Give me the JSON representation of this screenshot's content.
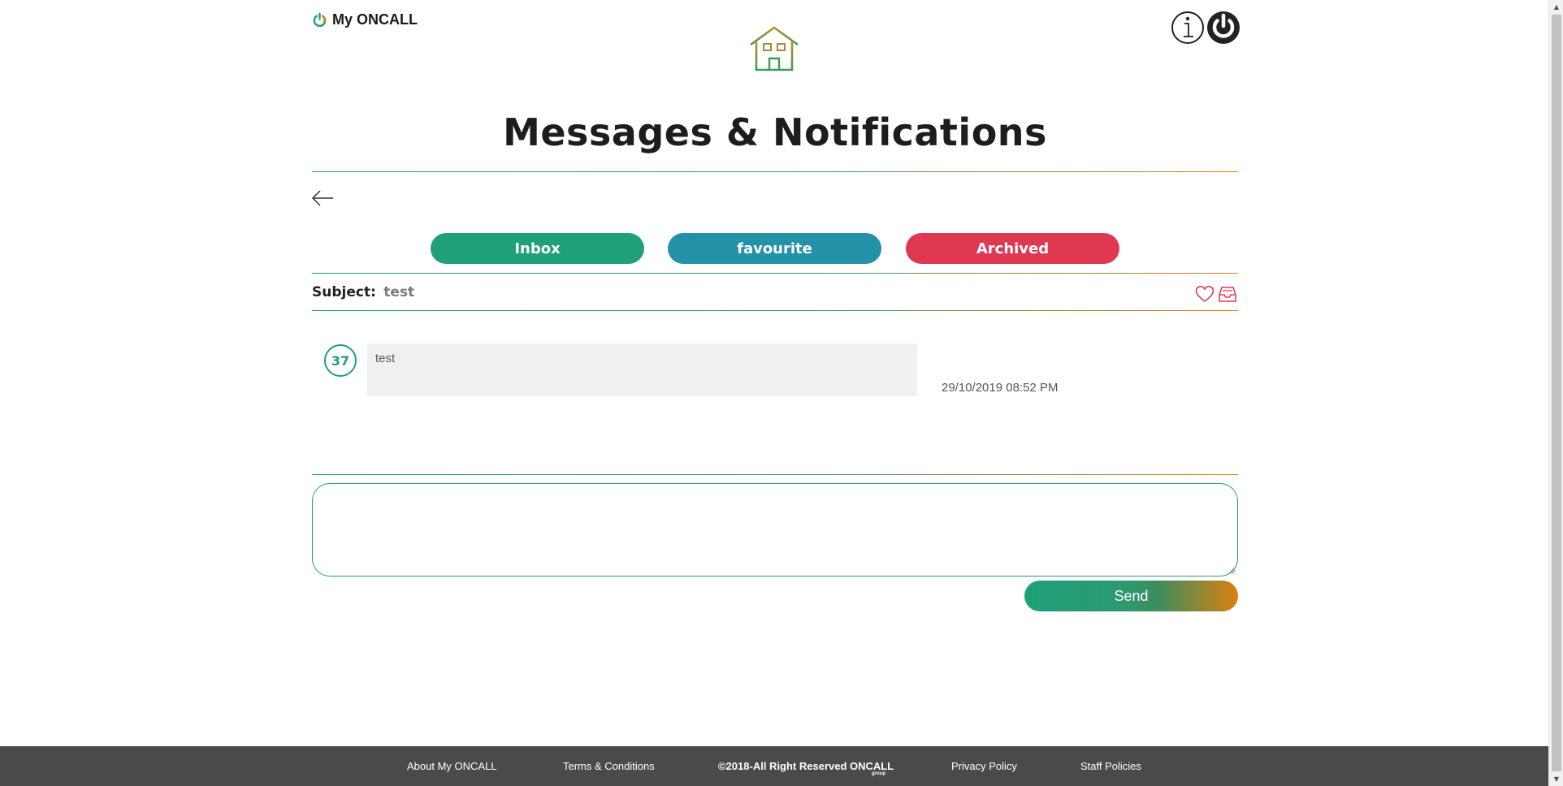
{
  "header": {
    "brand": "My ONCALL",
    "brand_icon": "power-icon",
    "home_icon": "home-icon",
    "info_icon": "info-icon",
    "power_icon": "power-icon"
  },
  "page": {
    "title": "Messages & Notifications"
  },
  "tabs": [
    {
      "label": "Inbox",
      "color": "#1fa078"
    },
    {
      "label": "favourite",
      "color": "#2391a8"
    },
    {
      "label": "Archived",
      "color": "#de3852"
    }
  ],
  "subject": {
    "label": "Subject:",
    "value": "test"
  },
  "messages": [
    {
      "badge": "37",
      "text": "test",
      "timestamp": "29/10/2019 08:52 PM"
    }
  ],
  "reply": {
    "value": "",
    "send_label": "Send"
  },
  "footer": {
    "about": "About My ONCALL",
    "terms": "Terms & Conditions",
    "copyright": "©2018-All Right Reserved ONCALL",
    "copyright_sub": "group",
    "privacy": "Privacy Policy",
    "staff": "Staff Policies"
  },
  "colors": {
    "green": "#1fa078",
    "teal": "#2391a8",
    "red": "#de3852",
    "orange": "#d9820f",
    "footer_bg": "#4a4a4a"
  }
}
